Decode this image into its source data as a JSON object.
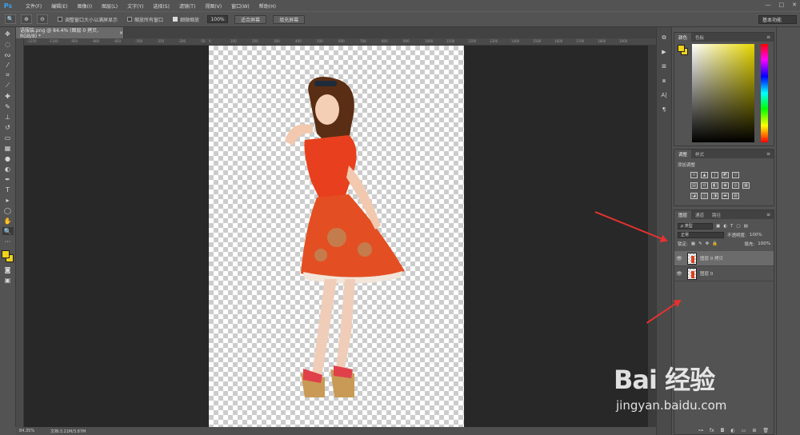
{
  "app": {
    "logo": "Ps"
  },
  "menu": [
    "文件(F)",
    "编辑(E)",
    "图像(I)",
    "图层(L)",
    "文字(Y)",
    "选择(S)",
    "滤镜(T)",
    "视图(V)",
    "窗口(W)",
    "帮助(H)"
  ],
  "window_controls": [
    "—",
    "□",
    "✕"
  ],
  "options": {
    "resize_windows_label": "调整窗口大小以满屏显示",
    "resize_windows_checked": false,
    "zoom_all_label": "缩放所有窗口",
    "zoom_all_checked": false,
    "scrubby_label": "细微缩放",
    "scrubby_checked": true,
    "zoom_value": "100%",
    "fit_screen": "适合屏幕",
    "fill_screen": "填充屏幕",
    "workspace": "基本功能"
  },
  "document": {
    "tab_title": "语服装.png @ 84.4% (图层 0 拷贝, RGB/8) *",
    "close": "×",
    "status_zoom": "84.35%",
    "status_doc": "文档:3.21M/3.87M"
  },
  "ruler_marks": [
    "-1250",
    "-1100",
    "-950",
    "-800",
    "-650",
    "-500",
    "-350",
    "-200",
    "-50",
    "0",
    "100",
    "200",
    "300",
    "400",
    "500",
    "600",
    "700",
    "800",
    "900",
    "1000",
    "1100",
    "1200",
    "1300",
    "1400",
    "1500",
    "1600",
    "1700",
    "1800",
    "1900"
  ],
  "panels": {
    "color_tabs": [
      "颜色",
      "色板"
    ],
    "adjust_tabs": [
      "调整",
      "样式"
    ],
    "adjust_title": "添加调整",
    "layers_tabs": [
      "图层",
      "通道",
      "路径"
    ],
    "filter_kind": "ρ 类型",
    "blend_mode": "正常",
    "opacity_label": "不透明度:",
    "opacity_value": "100%",
    "lock_label": "锁定:",
    "fill_label": "填充:",
    "fill_value": "100%",
    "layers": [
      {
        "name": "图层 0 拷贝",
        "selected": true
      },
      {
        "name": "图层 0",
        "selected": false
      }
    ]
  },
  "watermark": {
    "main": "Bai  经验",
    "url": "jingyan.baidu.com"
  },
  "colors": {
    "foreground": "#f0d21a",
    "arrow": "#e5322f",
    "accent": "#3aa0ea"
  }
}
